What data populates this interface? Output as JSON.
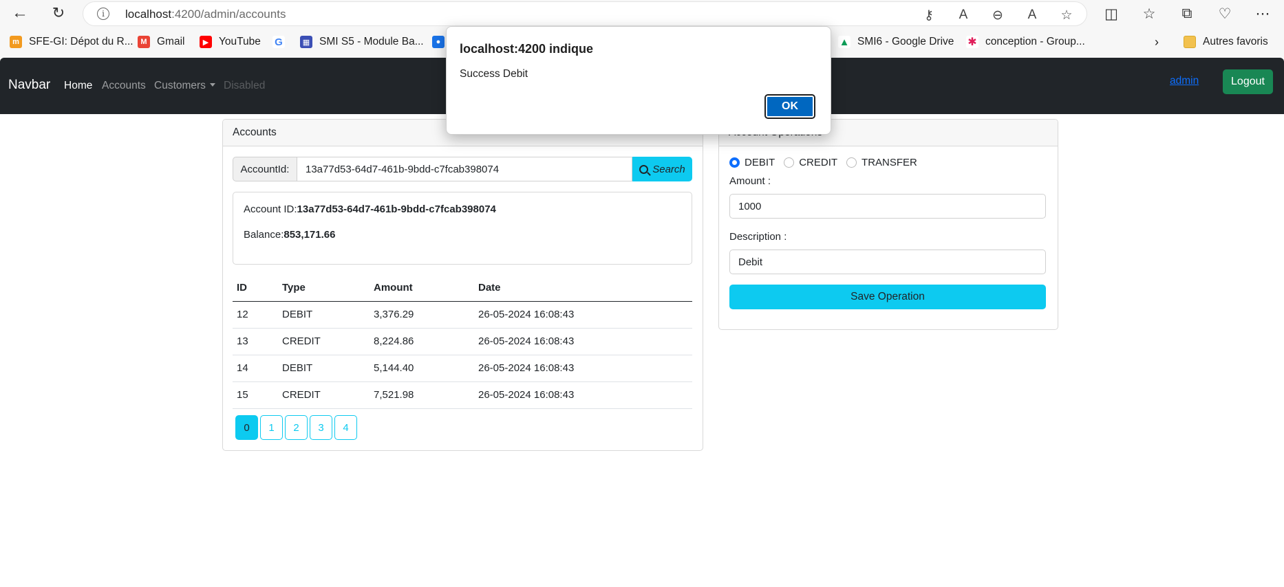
{
  "browser": {
    "url_host": "localhost",
    "url_port_path": ":4200/admin/accounts",
    "bookmarks": [
      "SFE-GI: Dépot du R...",
      "Gmail",
      "YouTube",
      "SMI S5 - Module Ba...",
      "SMI6 - Google Drive",
      "conception - Group...",
      "Autres favoris"
    ]
  },
  "navbar": {
    "brand": "Navbar",
    "links": [
      "Home",
      "Accounts",
      "Customers",
      "Disabled"
    ],
    "user": "admin",
    "logout": "Logout"
  },
  "accounts_card": {
    "header": "Accounts",
    "search_label": "AccountId:",
    "search_value": "13a77d53-64d7-461b-9bdd-c7fcab398074",
    "search_button": "Search",
    "account_id_label": "Account ID:",
    "account_id_value": "13a77d53-64d7-461b-9bdd-c7fcab398074",
    "balance_label": "Balance:",
    "balance_value": "853,171.66",
    "table": {
      "headers": [
        "ID",
        "Type",
        "Amount",
        "Date"
      ],
      "rows": [
        [
          "12",
          "DEBIT",
          "3,376.29",
          "26-05-2024 16:08:43"
        ],
        [
          "13",
          "CREDIT",
          "8,224.86",
          "26-05-2024 16:08:43"
        ],
        [
          "14",
          "DEBIT",
          "5,144.40",
          "26-05-2024 16:08:43"
        ],
        [
          "15",
          "CREDIT",
          "7,521.98",
          "26-05-2024 16:08:43"
        ]
      ]
    },
    "pages": [
      "0",
      "1",
      "2",
      "3",
      "4"
    ]
  },
  "operations_card": {
    "header": "Account Operations",
    "radio_options": [
      "DEBIT",
      "CREDIT",
      "TRANSFER"
    ],
    "amount_label": "Amount :",
    "amount_value": "1000",
    "description_label": "Description :",
    "description_value": "Debit",
    "save_button": "Save Operation"
  },
  "dialog": {
    "title": "localhost:4200 indique",
    "message": "Success Debit",
    "ok_button": "OK"
  },
  "colors": {
    "navbar_bg": "#212529",
    "info": "#0dcaf0",
    "success": "#198754",
    "primary": "#0d6efd",
    "dialog_button": "#0067c0"
  }
}
